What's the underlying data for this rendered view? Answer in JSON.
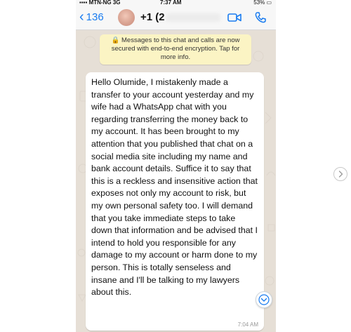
{
  "status_bar": {
    "carrier": "MTN-NG",
    "network": "3G",
    "time": "7:37 AM",
    "battery": "53%"
  },
  "nav": {
    "back_count": "136",
    "contact_name": "+1 (2",
    "icons": [
      "chevron-left-icon",
      "video-call-icon",
      "phone-call-icon"
    ],
    "accent_color": "#1a7cf0"
  },
  "encryption_notice": {
    "icon": "lock-icon",
    "text": "Messages to this chat and calls are now secured with end-to-end encryption. Tap for more info."
  },
  "message": {
    "text": "Hello Olumide,  I mistakenly made a transfer to your account yesterday and my wife had a WhatsApp chat with you regarding transferring the money back to my account. It has been brought to my attention that you published that chat on a social media site including my name and bank account details.  Suffice it to say that this is a reckless and insensitive action that exposes not only my account to risk, but my own personal safety too.  I will demand that you take immediate steps to take down that information and be advised that I intend to hold you responsible for any damage to my account or harm done to my person.  This is totally senseless and insane and I'll be talking to my lawyers about this.",
    "time": "7:04 AM"
  },
  "controls": {
    "scroll_down_icon": "chevron-down-circle-icon",
    "carousel_next_icon": "chevron-right-icon"
  }
}
